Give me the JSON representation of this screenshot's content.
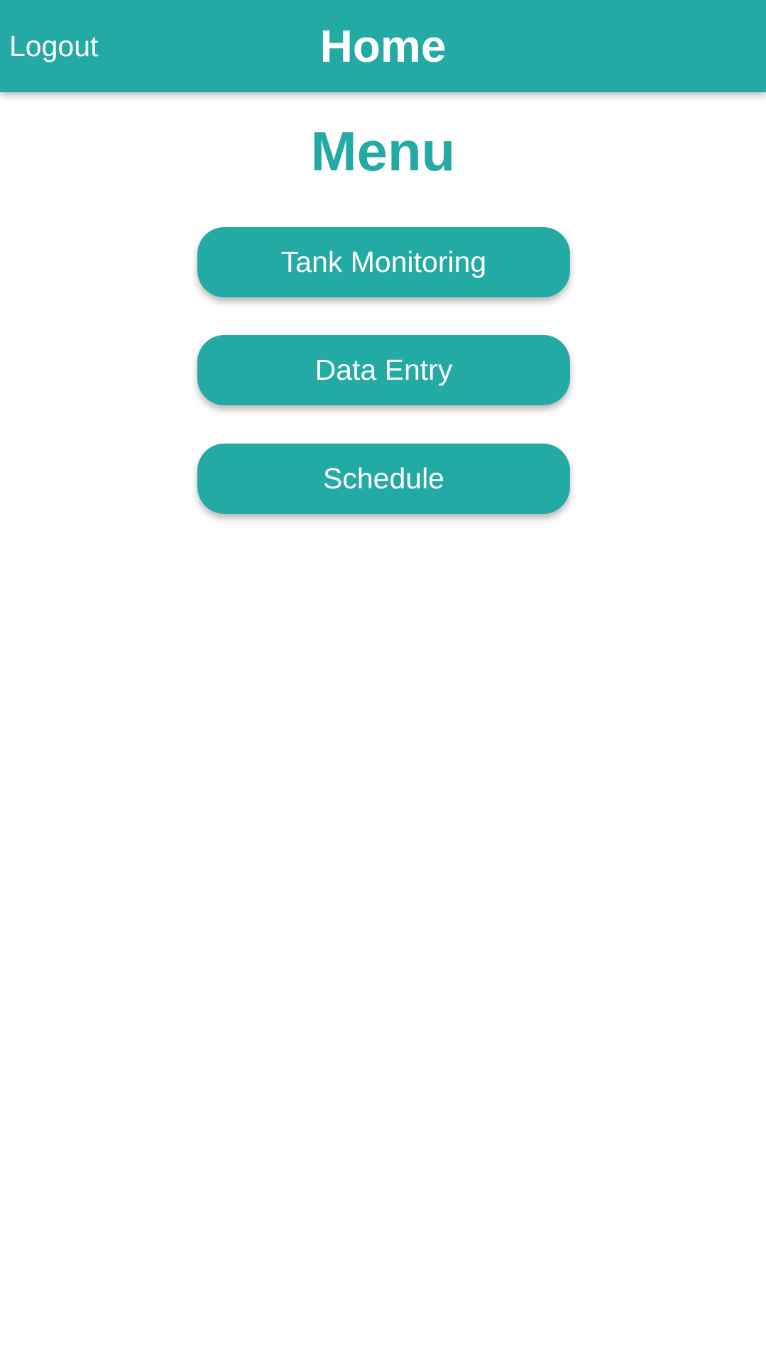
{
  "header": {
    "logout_label": "Logout",
    "title": "Home"
  },
  "menu": {
    "title": "Menu",
    "items": [
      {
        "label": "Tank Monitoring"
      },
      {
        "label": "Data Entry"
      },
      {
        "label": "Schedule"
      }
    ]
  },
  "colors": {
    "accent": "#23aaa4",
    "text_on_accent": "#ffffff",
    "background": "#ffffff"
  }
}
